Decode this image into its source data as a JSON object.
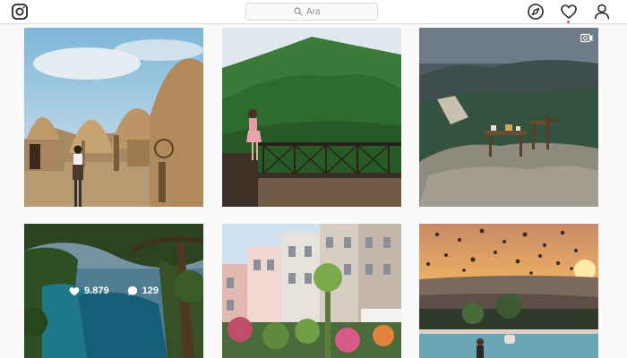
{
  "search": {
    "placeholder": "Ara"
  },
  "posts": [
    {
      "id": "post-1",
      "media": "photo"
    },
    {
      "id": "post-2",
      "media": "photo"
    },
    {
      "id": "post-3",
      "media": "video"
    },
    {
      "id": "post-4",
      "media": "photo",
      "hover": {
        "likes": "9.879",
        "comments": "129"
      }
    },
    {
      "id": "post-5",
      "media": "photo"
    },
    {
      "id": "post-6",
      "media": "photo"
    }
  ],
  "icons": {
    "logo": "instagram-logo-icon",
    "explore": "compass-icon",
    "activity": "heart-icon",
    "profile": "user-icon",
    "video": "video-camera-icon",
    "likes": "heart-icon",
    "comments": "comment-bubble-icon"
  },
  "colors": {
    "notification_dot": "#ed4956",
    "border": "#dbdbdb",
    "placeholder": "#8e8e8e"
  }
}
